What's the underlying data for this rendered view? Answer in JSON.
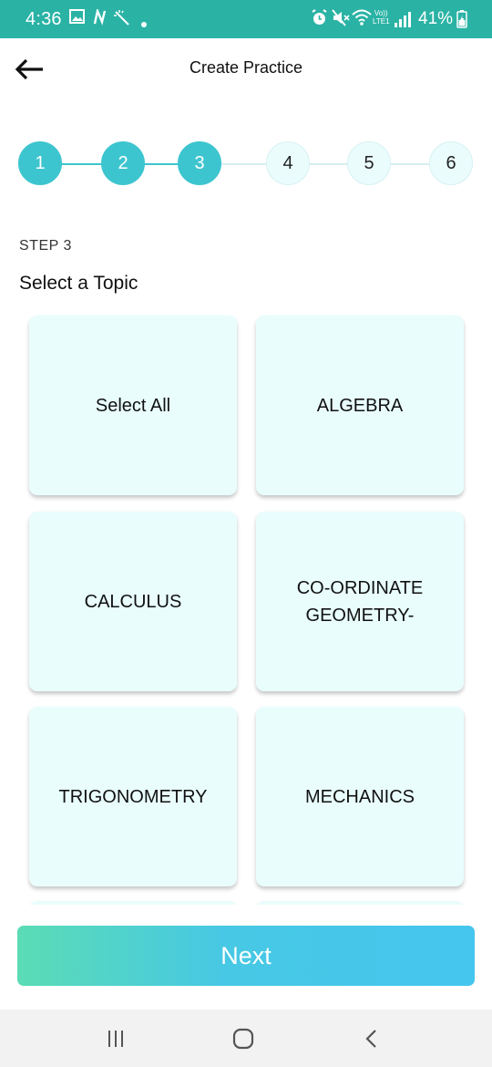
{
  "status_bar": {
    "time": "4:36",
    "network": "Vo))\nLTE1",
    "battery": "41%",
    "icons": [
      "gallery-icon",
      "n-notification-icon",
      "magic-wand-icon",
      "dot-icon",
      "alarm-icon",
      "mute-icon",
      "wifi-icon",
      "signal-icon",
      "battery-icon"
    ],
    "color": "#2ab3a5"
  },
  "header": {
    "title": "Create Practice",
    "back_icon": "arrow-left-icon"
  },
  "stepper": {
    "steps": [
      "1",
      "2",
      "3",
      "4",
      "5",
      "6"
    ],
    "completed": 3,
    "active_color": "#3dc5cf",
    "inactive_color": "#ebfcfd"
  },
  "step_label": "STEP 3",
  "section_title": "Select a Topic",
  "topics": [
    "Select All",
    "ALGEBRA",
    "CALCULUS",
    "CO-ORDINATE\nGEOMETRY-",
    "TRIGONOMETRY",
    "MECHANICS"
  ],
  "next_button": {
    "label": "Next"
  },
  "nav_bar": {
    "icons": [
      "recent-apps-icon",
      "home-icon",
      "back-icon"
    ]
  }
}
